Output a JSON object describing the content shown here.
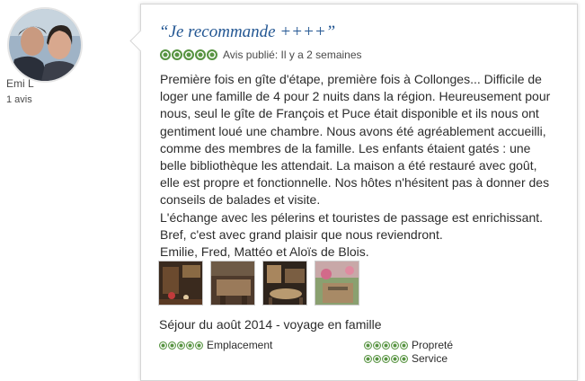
{
  "reviewer": {
    "name": "Emi L",
    "review_count": "1 avis"
  },
  "review": {
    "title": "“Je recommande ++++”",
    "rating": 5,
    "published": "Avis publié: Il y a 2 semaines",
    "body": [
      "Première fois en gîte d'étape, première fois à Collonges... Difficile de loger une famille de 4 pour 2 nuits dans la région. Heureusement pour nous, seul le gîte de François et Puce était disponible et ils nous ont gentiment loué une chambre. Nous avons été agréablement accueilli, comme des membres de la famille. Les enfants étaient gatés : une belle bibliothèque les attendait. La maison a été restauré avec goût, elle est propre et fonctionnelle. Nos hôtes n'hésitent pas à donner des conseils de balades et visite.",
      "L'échange avec les pélerins et touristes de passage est enrichissant.",
      "Bref, c'est avec grand plaisir que nous reviendront.",
      "Emilie, Fred, Mattéo et Aloïs de Blois."
    ],
    "stay": "Séjour du août 2014 - voyage en famille",
    "subratings": [
      {
        "label": "Emplacement",
        "rating": 5
      },
      {
        "label": "Propreté",
        "rating": 5
      },
      {
        "label": "Service",
        "rating": 5
      }
    ]
  },
  "colors": {
    "title": "#245793",
    "bubble": "#589442"
  }
}
